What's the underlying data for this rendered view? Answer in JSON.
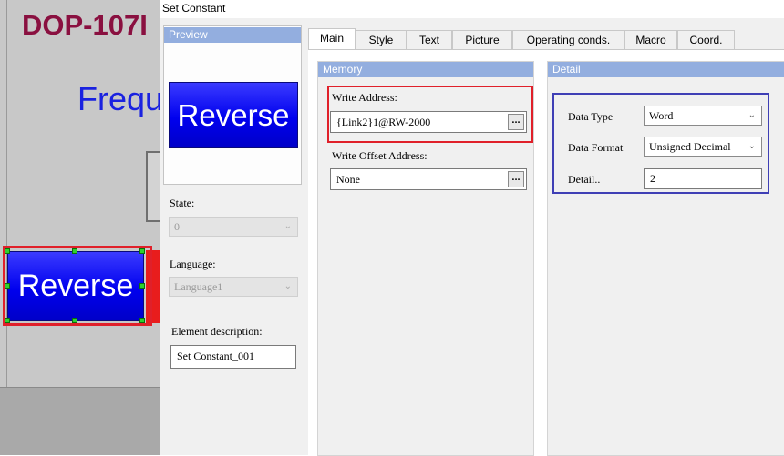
{
  "editor": {
    "model_title": "DOP-107I",
    "freq_label": "Freque",
    "canvas_button_label": "Reverse"
  },
  "dialog": {
    "title": "Set Constant",
    "preview": {
      "header": "Preview",
      "button_label": "Reverse"
    },
    "state": {
      "label": "State:",
      "value": "0"
    },
    "language": {
      "label": "Language:",
      "value": "Language1"
    },
    "description": {
      "label": "Element description:",
      "value": "Set Constant_001"
    },
    "tabs": [
      "Main",
      "Style",
      "Text",
      "Picture",
      "Operating conds.",
      "Macro",
      "Coord."
    ],
    "active_tab": "Main",
    "memory": {
      "header": "Memory",
      "write_address": {
        "label": "Write Address:",
        "value": "{Link2}1@RW-2000",
        "button": "..."
      },
      "write_offset": {
        "label": "Write Offset Address:",
        "value": "None",
        "button": "..."
      }
    },
    "detail": {
      "header": "Detail",
      "data_type": {
        "label": "Data Type",
        "value": "Word"
      },
      "data_format": {
        "label": "Data Format",
        "value": "Unsigned Decimal"
      },
      "detail_field": {
        "label": "Detail..",
        "value": "2"
      }
    }
  },
  "colors": {
    "highlight_red": "#e0202a",
    "highlight_blue": "#3f3fb5",
    "button_blue": "#0000ee",
    "panel_header": "#93aedf",
    "title_maroon": "#8a1040"
  },
  "icons": {
    "dropdown": "chevron-down-icon",
    "browse": "ellipsis-button"
  }
}
